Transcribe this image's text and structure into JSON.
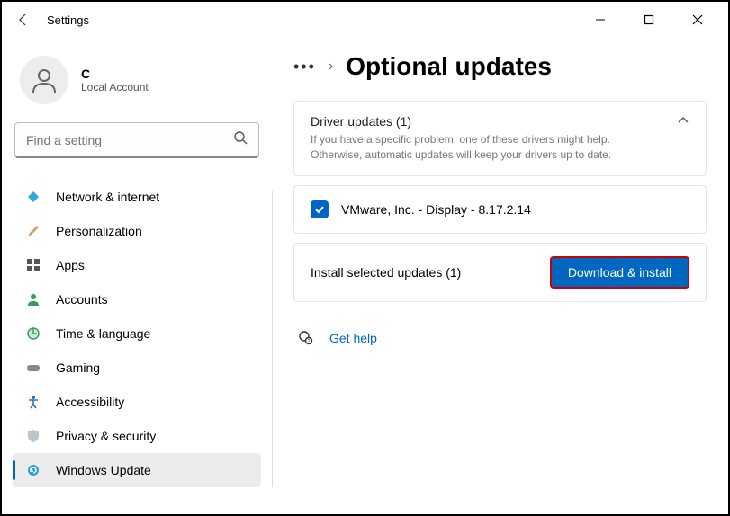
{
  "window": {
    "title": "Settings"
  },
  "user": {
    "name": "C",
    "sub": "Local Account"
  },
  "search": {
    "placeholder": "Find a setting"
  },
  "sidebar": {
    "items": [
      {
        "label": "Network & internet"
      },
      {
        "label": "Personalization"
      },
      {
        "label": "Apps"
      },
      {
        "label": "Accounts"
      },
      {
        "label": "Time & language"
      },
      {
        "label": "Gaming"
      },
      {
        "label": "Accessibility"
      },
      {
        "label": "Privacy & security"
      },
      {
        "label": "Windows Update"
      }
    ]
  },
  "main": {
    "dots": "•••",
    "sep": "›",
    "title": "Optional updates",
    "driver_section": {
      "title": "Driver updates (1)",
      "sub": "If you have a specific problem, one of these drivers might help. Otherwise, automatic updates will keep your drivers up to date."
    },
    "driver_item": {
      "label": "VMware, Inc. - Display - 8.17.2.14"
    },
    "install": {
      "text": "Install selected updates (1)",
      "button": "Download & install"
    },
    "help": {
      "label": "Get help"
    }
  }
}
